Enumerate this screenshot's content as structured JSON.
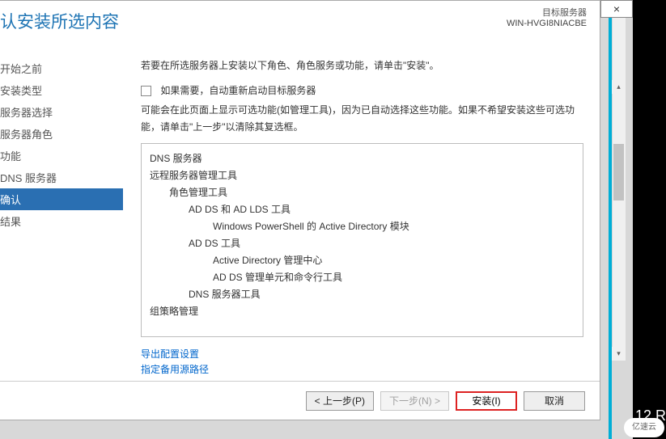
{
  "header": {
    "title": "认安装所选内容",
    "target_label": "目标服务器",
    "server_name": "WIN-HVGI8NIACBE"
  },
  "sidebar": {
    "items": [
      {
        "label": "开始之前"
      },
      {
        "label": "安装类型"
      },
      {
        "label": "服务器选择"
      },
      {
        "label": "服务器角色"
      },
      {
        "label": "功能"
      },
      {
        "label": "DNS 服务器"
      },
      {
        "label": "确认",
        "selected": true
      },
      {
        "label": "结果"
      }
    ]
  },
  "main": {
    "intro": "若要在所选服务器上安装以下角色、角色服务或功能，请单击\"安装\"。",
    "checkbox_label": "如果需要，自动重新启动目标服务器",
    "note": "可能会在此页面上显示可选功能(如管理工具)，因为已自动选择这些功能。如果不希望安装这些可选功能，请单击\"上一步\"以清除其复选框。",
    "tree": [
      {
        "lvl": 0,
        "text": "DNS 服务器"
      },
      {
        "lvl": 0,
        "text": "远程服务器管理工具"
      },
      {
        "lvl": 1,
        "text": "角色管理工具"
      },
      {
        "lvl": 2,
        "text": "AD DS 和 AD LDS 工具"
      },
      {
        "lvl": 3,
        "text": "Windows PowerShell 的 Active Directory 模块"
      },
      {
        "lvl": 2,
        "text": "AD DS 工具"
      },
      {
        "lvl": 3,
        "text": "Active Directory 管理中心"
      },
      {
        "lvl": 3,
        "text": "AD DS 管理单元和命令行工具"
      },
      {
        "lvl": 2,
        "text": "DNS 服务器工具"
      },
      {
        "lvl": 0,
        "text": "组策略管理"
      }
    ],
    "links": {
      "export": "导出配置设置",
      "alt_source": "指定备用源路径"
    }
  },
  "footer": {
    "prev": "< 上一步(P)",
    "next": "下一步(N) >",
    "install": "安装(I)",
    "cancel": "取消"
  },
  "outer": {
    "os_label": "12 R",
    "logo": "亿速云",
    "close": "×",
    "scroll_up": "▴",
    "scroll_down": "▾"
  }
}
